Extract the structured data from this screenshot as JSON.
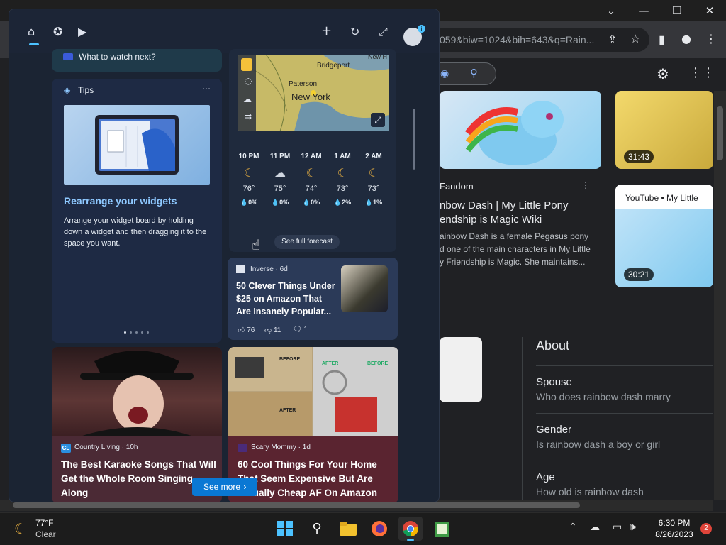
{
  "chrome": {
    "url": "059&biw=1024&bih=643&q=Rain...",
    "window_controls": {
      "chevron": "⌄",
      "minimize": "—",
      "restore": "❐",
      "close": "✕"
    },
    "results": {
      "fandom_source": "Fandom",
      "fandom_title": "nbow Dash | My Little Pony\nendship is Magic Wiki",
      "fandom_snippet": "ainbow Dash is a female Pegasus pony\nd one of the main characters in My Little\ny Friendship is Magic. She maintains...",
      "video1_duration": "31:43",
      "video2_source": "YouTube • My Little",
      "video2_duration": "30:21"
    },
    "knowledge_panel": {
      "about": "About",
      "rows": [
        {
          "title": "Spouse",
          "sub": "Who does rainbow dash marry"
        },
        {
          "title": "Gender",
          "sub": "Is rainbow dash a boy or girl"
        },
        {
          "title": "Age",
          "sub": "How old is rainbow dash"
        }
      ]
    }
  },
  "widgets": {
    "topbar_icons": [
      "home-icon",
      "add-widget-icon",
      "play-icon",
      "plus-icon",
      "refresh-icon",
      "expand-icon",
      "avatar"
    ],
    "avatar_badge": "i",
    "what_to_watch": "What to watch next?",
    "tips": {
      "label": "Tips",
      "title": "Rearrange your widgets",
      "desc": "Arrange your widget board by holding down a widget and then dragging it to the space you want."
    },
    "weather": {
      "map_labels": [
        "Bridgeport",
        "Paterson",
        "New York",
        "New H"
      ],
      "forecast": [
        {
          "time": "10 PM",
          "icon": "☾",
          "temp": "76°",
          "precip": "💧0%"
        },
        {
          "time": "11 PM",
          "icon": "☁",
          "temp": "75°",
          "precip": "💧0%"
        },
        {
          "time": "12 AM",
          "icon": "☾",
          "temp": "74°",
          "precip": "💧0%"
        },
        {
          "time": "1 AM",
          "icon": "☾",
          "temp": "73°",
          "precip": "💧2%"
        },
        {
          "time": "2 AM",
          "icon": "☾",
          "temp": "73°",
          "precip": "💧1%"
        }
      ],
      "see_full": "See full forecast"
    },
    "inverse": {
      "source": "Inverse · 6d",
      "title": "50 Clever Things Under $25 on Amazon That Are Insanely Popular...",
      "likes": "76",
      "dislikes": "11",
      "comments": "1"
    },
    "karaoke": {
      "source_badge": "CL",
      "source": "Country Living · 10h",
      "title": "The Best Karaoke Songs That Will Get the Whole Room Singing Along"
    },
    "mommy": {
      "source": "Scary Mommy · 1d",
      "title": "60 Cool Things For Your Home That Seem Expensive But Are Actually Cheap AF On Amazon",
      "img_labels": [
        "BEFORE",
        "AFTER",
        "BEFORE",
        "AFTER"
      ]
    },
    "see_more": "See more",
    "colors": {
      "accent": "#4cc2ff",
      "see_more": "#0a78d4"
    }
  },
  "taskbar": {
    "weather_temp": "77°F",
    "weather_cond": "Clear",
    "apps": [
      "windows-start-icon",
      "search-icon",
      "file-explorer-icon",
      "firefox-icon",
      "chrome-icon",
      "notepad-icon"
    ],
    "time": "6:30 PM",
    "date": "8/26/2023",
    "notif_count": "2"
  }
}
